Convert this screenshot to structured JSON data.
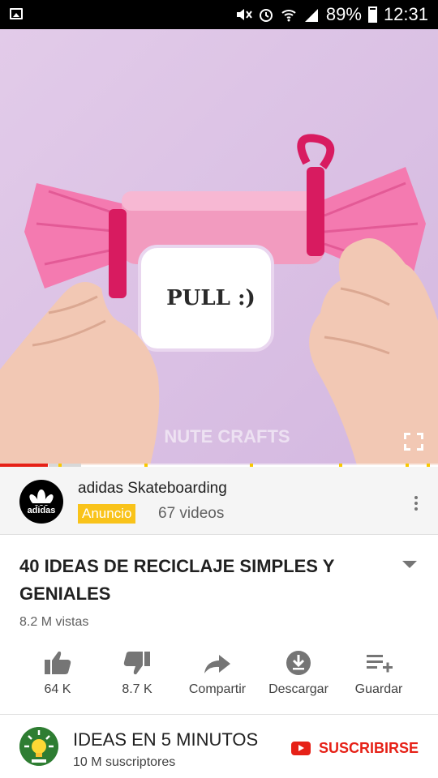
{
  "status_bar": {
    "battery": "89%",
    "time": "12:31"
  },
  "video": {
    "overlay_text": "PULL :)",
    "watermark": "NUTE CRAFTS",
    "progress_fraction": 0.11
  },
  "ad": {
    "logo_text": "adidas",
    "name": "adidas Skateboarding",
    "badge": "Anuncio",
    "video_count": "67 videos"
  },
  "video_info": {
    "title": "40 IDEAS DE RECICLAJE SIMPLES Y GENIALES",
    "views": "8.2 M vistas"
  },
  "actions": [
    {
      "icon": "thumbs-up-icon",
      "label": "64 K"
    },
    {
      "icon": "thumbs-down-icon",
      "label": "8.7 K"
    },
    {
      "icon": "share-icon",
      "label": "Compartir"
    },
    {
      "icon": "download-icon",
      "label": "Descargar"
    },
    {
      "icon": "add-to-playlist-icon",
      "label": "Guardar"
    }
  ],
  "channel": {
    "name": "IDEAS EN 5 MINUTOS",
    "subscribers": "10 M suscriptores",
    "subscribe_label": "SUSCRIBIRSE"
  },
  "colors": {
    "accent_red": "#e62117",
    "ad_badge_yellow": "#f9c31a"
  }
}
